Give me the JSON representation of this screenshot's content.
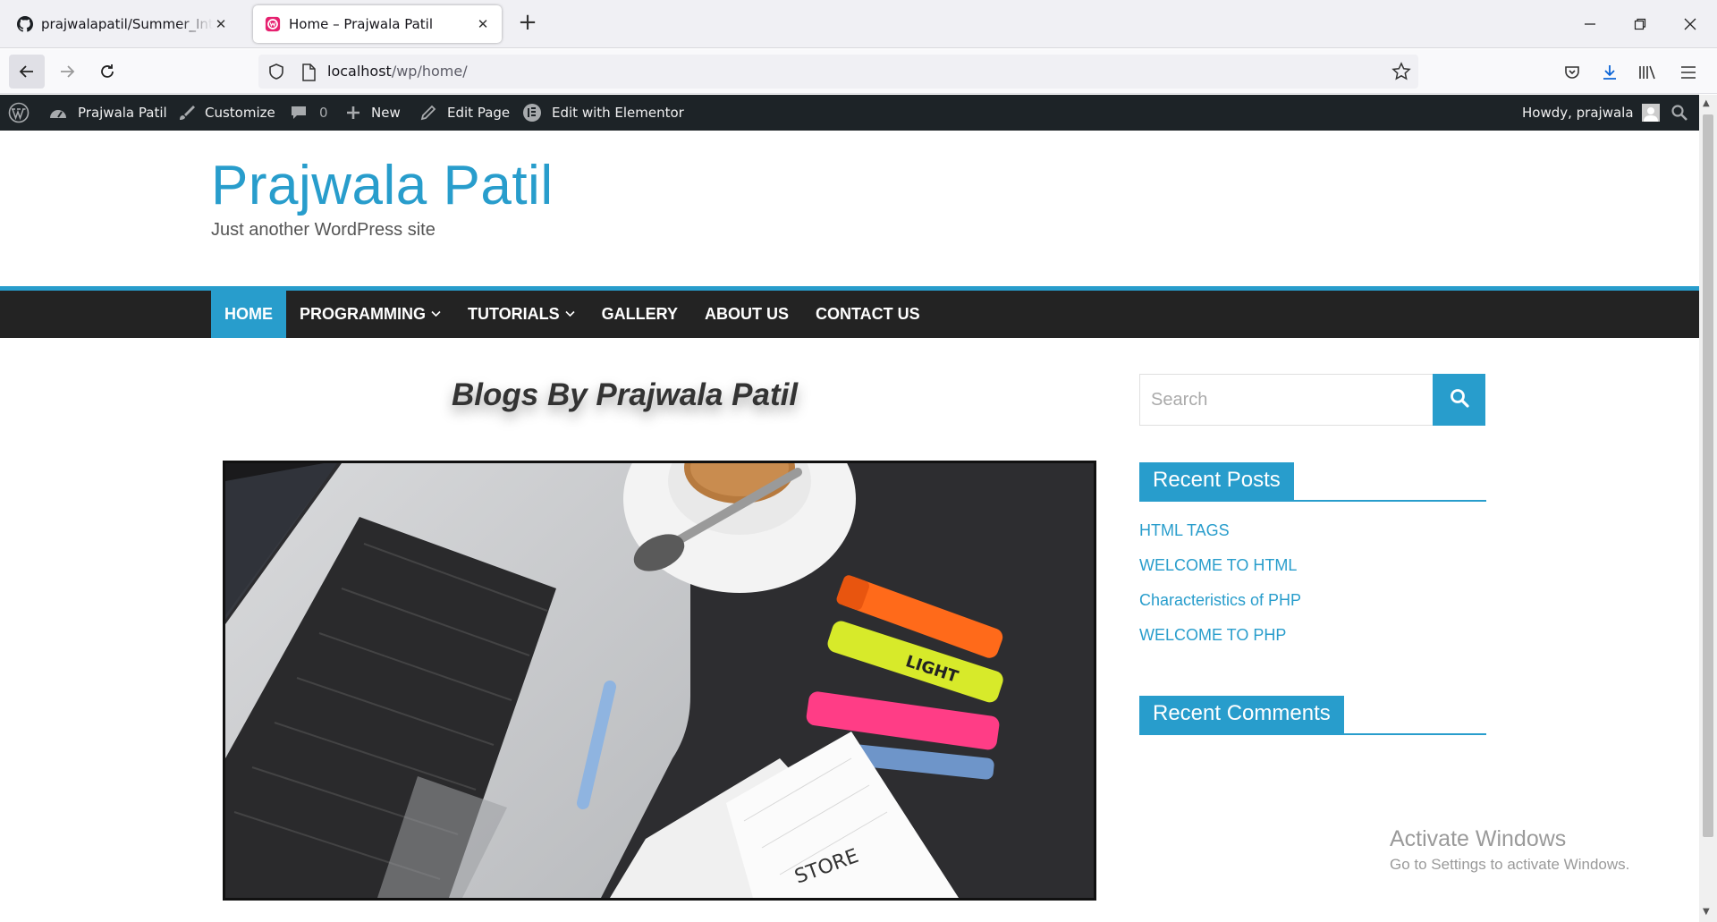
{
  "browser": {
    "tabs": [
      {
        "title": "prajwalapatil/Summer_Internship",
        "icon": "github-icon",
        "active": false
      },
      {
        "title": "Home – Prajwala Patil",
        "icon": "wordpress-local-icon",
        "active": true
      }
    ],
    "url_host": "localhost",
    "url_path": "/wp/home/"
  },
  "adminbar": {
    "site_name": "Prajwala Patil",
    "customize": "Customize",
    "comments_count": "0",
    "new": "New",
    "edit_page": "Edit Page",
    "elementor": "Edit with Elementor",
    "howdy": "Howdy, prajwala"
  },
  "site": {
    "title": "Prajwala Patil",
    "description": "Just another WordPress site"
  },
  "menu": [
    {
      "label": "HOME",
      "active": true,
      "has_children": false
    },
    {
      "label": "PROGRAMMING",
      "active": false,
      "has_children": true
    },
    {
      "label": "TUTORIALS",
      "active": false,
      "has_children": true
    },
    {
      "label": "GALLERY",
      "active": false,
      "has_children": false
    },
    {
      "label": "ABOUT US",
      "active": false,
      "has_children": false
    },
    {
      "label": "CONTACT US",
      "active": false,
      "has_children": false
    }
  ],
  "content": {
    "heading": "Blogs By Prajwala Patil",
    "hero_image": "laptop-coffee-highlighters-photo"
  },
  "sidebar": {
    "search_placeholder": "Search",
    "recent_posts_title": "Recent Posts",
    "recent_posts": [
      "HTML TAGS",
      "WELCOME TO HTML",
      "Characteristics of PHP",
      "WELCOME TO PHP"
    ],
    "recent_comments_title": "Recent Comments"
  },
  "watermark": {
    "line1": "Activate Windows",
    "line2": "Go to Settings to activate Windows."
  },
  "colors": {
    "accent": "#289dcc",
    "adminbar": "#1d2327",
    "nav": "#232323"
  }
}
